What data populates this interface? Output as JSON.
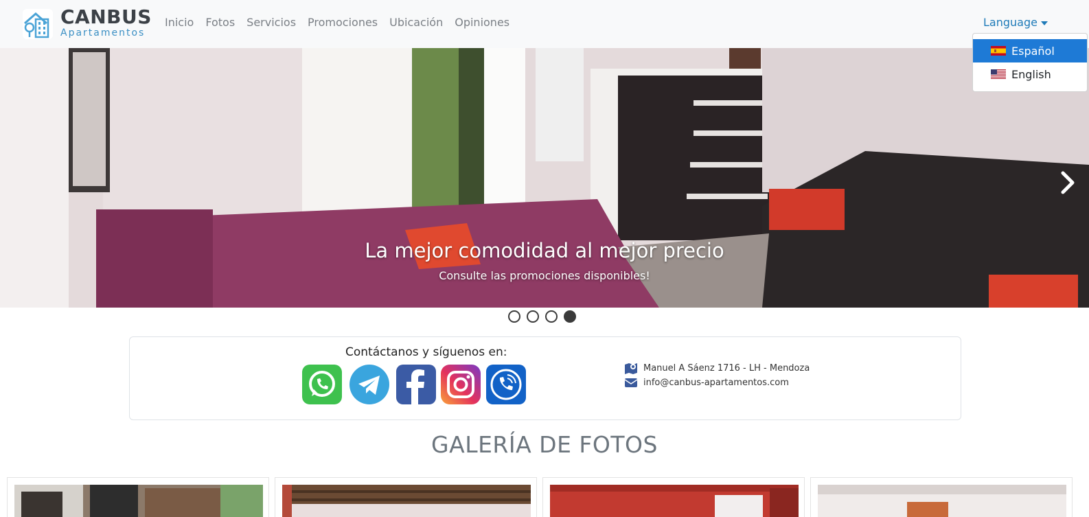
{
  "brand": {
    "name": "CANBUS",
    "subtitle": "Apartamentos"
  },
  "nav": {
    "links": [
      "Inicio",
      "Fotos",
      "Servicios",
      "Promociones",
      "Ubicación",
      "Opiniones"
    ],
    "language_label": "Language"
  },
  "language_menu": {
    "items": [
      {
        "label": "Español",
        "flag": "spain-flag-icon",
        "active": true
      },
      {
        "label": "English",
        "flag": "usa-flag-icon",
        "active": false
      }
    ],
    "highlight_color": "#1e7ad6"
  },
  "hero": {
    "title": "La mejor comodidad al mejor precio",
    "subtitle": "Consulte las promociones disponibles!",
    "slides_total": 4,
    "active_slide": 4
  },
  "contact": {
    "title": "Contáctanos y síguenos en:",
    "social": [
      "whatsapp-icon",
      "telegram-icon",
      "facebook-icon",
      "instagram-icon",
      "phone-icon"
    ],
    "address": "Manuel A Sáenz 1716 - LH - Mendoza",
    "email": "info@canbus-apartamentos.com"
  },
  "gallery": {
    "title": "GALERÍA DE FOTOS"
  },
  "colors": {
    "brand_blue": "#3a8fc4",
    "link_blue": "#1d7ab8",
    "navbar_bg": "#f8f9fa"
  }
}
